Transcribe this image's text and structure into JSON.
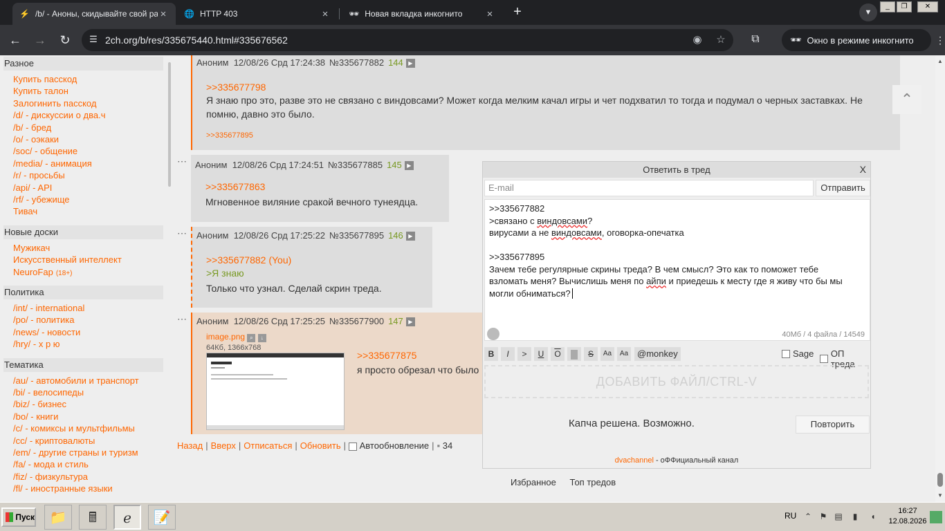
{
  "browser": {
    "tabs": [
      {
        "title": "/b/ - Аноны, скидывайте свой раб",
        "active": true
      },
      {
        "title": "HTTP 403",
        "active": false
      },
      {
        "title": "Новая вкладка инкогнито",
        "active": false
      }
    ],
    "url_host": "2ch.org",
    "url_path": "/b/res/335675440.html#335676562",
    "incognito_label": "Окно в режиме инкогнито"
  },
  "sidebar": {
    "sections": [
      {
        "head": "Разное",
        "items": [
          "Купить пасскод",
          "Купить талон",
          "Залогинить пасскод",
          "/d/ - дискуссии о два.ч",
          "/b/ - бред",
          "/o/ - оэкаки",
          "/soc/ - общение",
          "/media/ - анимация",
          "/r/ - просьбы",
          "/api/ - API",
          "/rf/ - убежище",
          "Тивач"
        ]
      },
      {
        "head": "Новые доски",
        "items": [
          "Мужикач",
          "Искусственный интеллект",
          "NeuroFap"
        ],
        "tag": "(18+)"
      },
      {
        "head": "Политика",
        "items": [
          "/int/ - international",
          "/po/ - политика",
          "/news/ - новости",
          "/hry/ - х р ю"
        ]
      },
      {
        "head": "Тематика",
        "items": [
          "/au/ - автомобили и транспорт",
          "/bi/ - велосипеды",
          "/biz/ - бизнес",
          "/bo/ - книги",
          "/c/ - комиксы и мультфильмы",
          "/cc/ - криптовалюты",
          "/em/ - другие страны и туризм",
          "/fa/ - мода и стиль",
          "/fiz/ - физкультура",
          "/fl/ - иностранные языки"
        ]
      }
    ]
  },
  "posts": [
    {
      "author": "Аноним",
      "date": "12/08/26 Срд 17:24:38",
      "num": "№335677882",
      "count": "144",
      "reply_to": ">>335677798",
      "text": "Я знаю про это, разве это не связано с виндовсами? Может когда мелким качал игры и чет подхватил то тогда и подумал о черных заставках. Не помню, давно это было.",
      "backlink": ">>335677895"
    },
    {
      "author": "Аноним",
      "date": "12/08/26 Срд 17:24:51",
      "num": "№335677885",
      "count": "145",
      "reply_to": ">>335677863",
      "text": "Мгновенное виляние сракой вечного тунеядца."
    },
    {
      "author": "Аноним",
      "date": "12/08/26 Срд 17:25:22",
      "num": "№335677895",
      "count": "146",
      "reply_to": ">>335677882 (You)",
      "quote": ">Я знаю",
      "text": "Только что узнал. Сделай скрин треда."
    },
    {
      "author": "Аноним",
      "date": "12/08/26 Срд 17:25:25",
      "num": "№335677900",
      "count": "147",
      "file_name": "image.png",
      "file_meta": "64Кб, 1366x768",
      "reply_to": ">>335677875",
      "text": "я просто обрезал что было"
    }
  ],
  "bottom_nav": {
    "back": "Назад",
    "top": "Вверх",
    "unsubscribe": "Отписаться",
    "refresh": "Обновить",
    "autoupdate": "Автообновление",
    "count": "34"
  },
  "reply_form": {
    "title": "Ответить в тред",
    "close": "X",
    "email_placeholder": "E-mail",
    "send": "Отправить",
    "text_lines": [
      ">>335677882",
      ">связано с виндовсами?",
      "вирусами а не виндовсами, оговорка-опечатка",
      "",
      ">>335677895",
      "Зачем тебе регулярные скрины треда? В чем смысл? Это как то поможет тебе",
      "взломать меня? Вычислишь меня по айпи и приедешь к месту где я живу что бы мы",
      "могли обниматься?"
    ],
    "counter": "40Мб / 4 файла / 14549",
    "markup": {
      "b": "B",
      "i": "I",
      "q": ">",
      "u": "U",
      "o": "O",
      "sp": "",
      "s": "S",
      "sup": "Aa",
      "sub": "Aa",
      "monkey": "@monkey"
    },
    "sage": "Sage",
    "op": "ОП треда",
    "dropzone": "ДОБАВИТЬ ФАЙЛ/CTRL-V",
    "captcha": "Капча решена. Возможно.",
    "retry": "Повторить",
    "footer_link": "dvachannel",
    "footer_text": " - оФФициальный канал"
  },
  "under_tabs": [
    "Избранное",
    "Топ тредов"
  ],
  "taskbar": {
    "start": "Пуск",
    "lang": "RU",
    "time": "16:27",
    "date": "12.08.2026"
  }
}
